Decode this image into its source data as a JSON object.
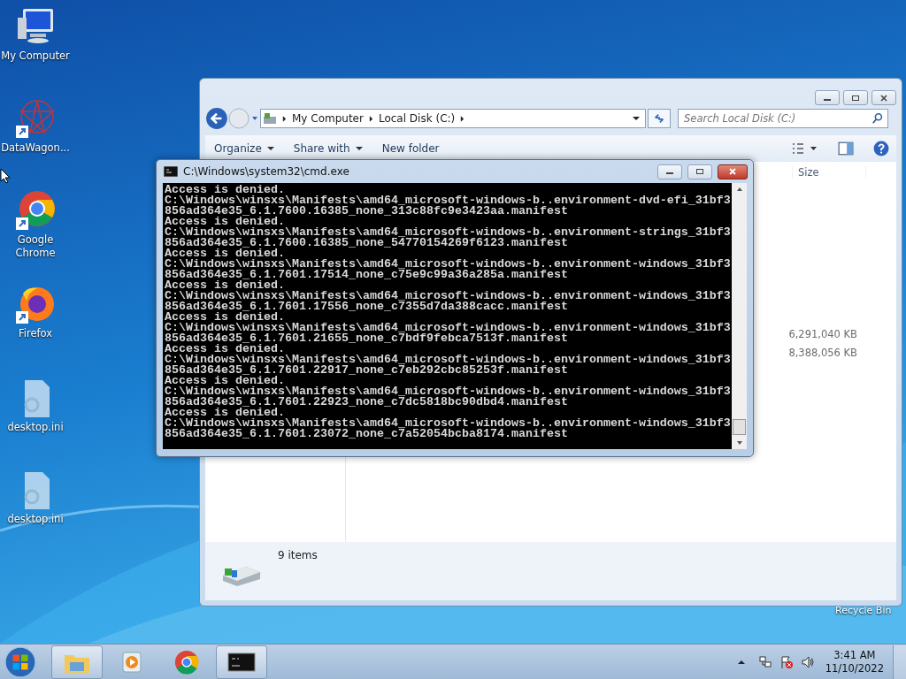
{
  "desktop_icons": [
    {
      "kind": "computer",
      "label": "My Computer"
    },
    {
      "kind": "datawagon",
      "label": "DataWagon..."
    },
    {
      "kind": "chrome",
      "label": "Google Chrome"
    },
    {
      "kind": "firefox",
      "label": "Firefox"
    },
    {
      "kind": "ini",
      "label": "desktop.ini"
    },
    {
      "kind": "ini",
      "label": "desktop.ini"
    }
  ],
  "recycle_bin": {
    "label": "Recycle Bin"
  },
  "explorer": {
    "breadcrumbs": [
      "My Computer",
      "Local Disk (C:)"
    ],
    "search": {
      "placeholder": "Search Local Disk (C:)"
    },
    "toolbar": [
      {
        "label": "Organize",
        "dropdown": true
      },
      {
        "label": "Share with",
        "dropdown": true
      },
      {
        "label": "New folder",
        "dropdown": false
      }
    ],
    "columns": [
      "Size"
    ],
    "sizes": [
      "6,291,040 KB",
      "8,388,056 KB"
    ],
    "status_bar": "9 items"
  },
  "cmd": {
    "title": "C:\\Windows\\system32\\cmd.exe",
    "lines": [
      "Access is denied.",
      "C:\\Windows\\winsxs\\Manifests\\amd64_microsoft-windows-b..environment-dvd-efi_31bf3",
      "856ad364e35_6.1.7600.16385_none_313c88fc9e3423aa.manifest",
      "Access is denied.",
      "C:\\Windows\\winsxs\\Manifests\\amd64_microsoft-windows-b..environment-strings_31bf3",
      "856ad364e35_6.1.7600.16385_none_54770154269f6123.manifest",
      "Access is denied.",
      "C:\\Windows\\winsxs\\Manifests\\amd64_microsoft-windows-b..environment-windows_31bf3",
      "856ad364e35_6.1.7601.17514_none_c75e9c99a36a285a.manifest",
      "Access is denied.",
      "C:\\Windows\\winsxs\\Manifests\\amd64_microsoft-windows-b..environment-windows_31bf3",
      "856ad364e35_6.1.7601.17556_none_c7355d7da388cacc.manifest",
      "Access is denied.",
      "C:\\Windows\\winsxs\\Manifests\\amd64_microsoft-windows-b..environment-windows_31bf3",
      "856ad364e35_6.1.7601.21655_none_c7bdf9febca7513f.manifest",
      "Access is denied.",
      "C:\\Windows\\winsxs\\Manifests\\amd64_microsoft-windows-b..environment-windows_31bf3",
      "856ad364e35_6.1.7601.22917_none_c7eb292cbc85253f.manifest",
      "Access is denied.",
      "C:\\Windows\\winsxs\\Manifests\\amd64_microsoft-windows-b..environment-windows_31bf3",
      "856ad364e35_6.1.7601.22923_none_c7dc5818bc90dbd4.manifest",
      "Access is denied.",
      "C:\\Windows\\winsxs\\Manifests\\amd64_microsoft-windows-b..environment-windows_31bf3",
      "856ad364e35_6.1.7601.23072_none_c7a52054bcba8174.manifest"
    ]
  },
  "taskbar": {
    "items": [
      {
        "kind": "explorer",
        "open": true
      },
      {
        "kind": "media",
        "open": false
      },
      {
        "kind": "chrome",
        "open": false
      },
      {
        "kind": "cmd",
        "open": true
      }
    ],
    "time": "3:41 AM",
    "date": "11/10/2022"
  }
}
